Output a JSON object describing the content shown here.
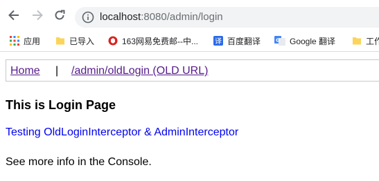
{
  "browser": {
    "url_host": "localhost",
    "url_rest": ":8080/admin/login"
  },
  "bookmarks": [
    {
      "label": "应用",
      "icon": "apps-grid-icon"
    },
    {
      "label": "已导入",
      "icon": "folder-icon"
    },
    {
      "label": "163网易免费邮--中...",
      "icon": "163-mail-icon"
    },
    {
      "label": "百度翻译",
      "icon": "baidu-translate-icon"
    },
    {
      "label": "Google 翻译",
      "icon": "google-translate-icon"
    },
    {
      "label": "工作",
      "icon": "folder-icon"
    }
  ],
  "page": {
    "nav": {
      "home": "Home",
      "separator": "|",
      "old_login": "/admin/oldLogin (OLD URL)"
    },
    "heading": "This is Login Page",
    "link_text": "Testing OldLoginInterceptor & AdminInterceptor",
    "info": "See more info in the Console."
  }
}
